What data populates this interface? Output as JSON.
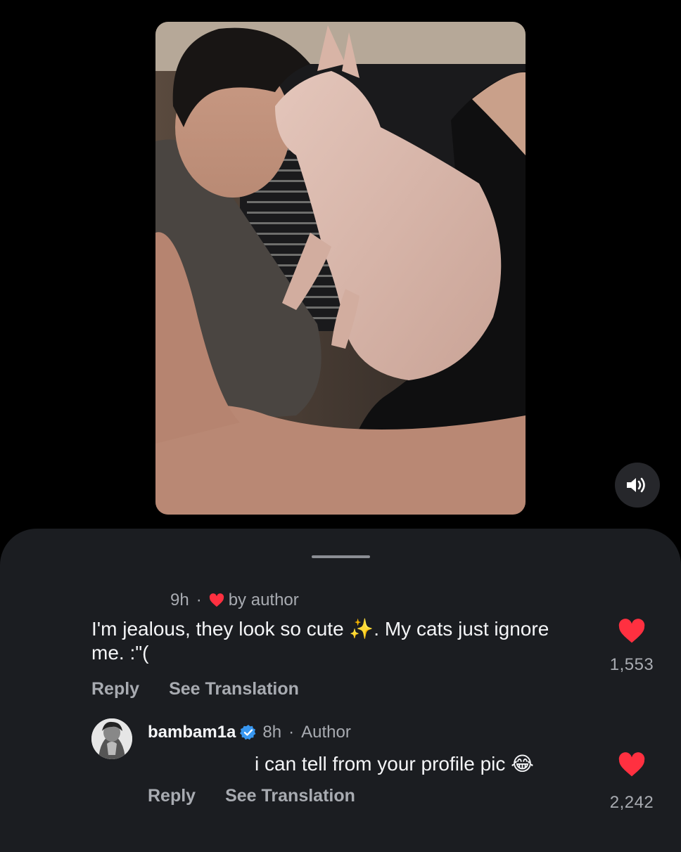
{
  "video": {
    "mute_icon": "speaker-volume-icon"
  },
  "comments": [
    {
      "time": "9h",
      "separator": "·",
      "liked_by_author": "by author",
      "text": "I'm jealous, they look so cute ✨. My cats just ignore me. :\"(",
      "actions": {
        "reply": "Reply",
        "translate": "See Translation"
      },
      "likes": "1,553",
      "like_color": "#ff3040"
    },
    {
      "username": "bambam1a",
      "verified": true,
      "time": "8h",
      "separator": "·",
      "author_tag": "Author",
      "text": "i can tell from your profile pic 😂",
      "actions": {
        "reply": "Reply",
        "translate": "See Translation"
      },
      "likes": "2,242",
      "like_color": "#ff3040"
    }
  ],
  "colors": {
    "background": "#000000",
    "sheet": "#1b1d21",
    "muted_text": "#a8abb1",
    "accent_red": "#ff3040",
    "verified_blue": "#3897f0"
  }
}
